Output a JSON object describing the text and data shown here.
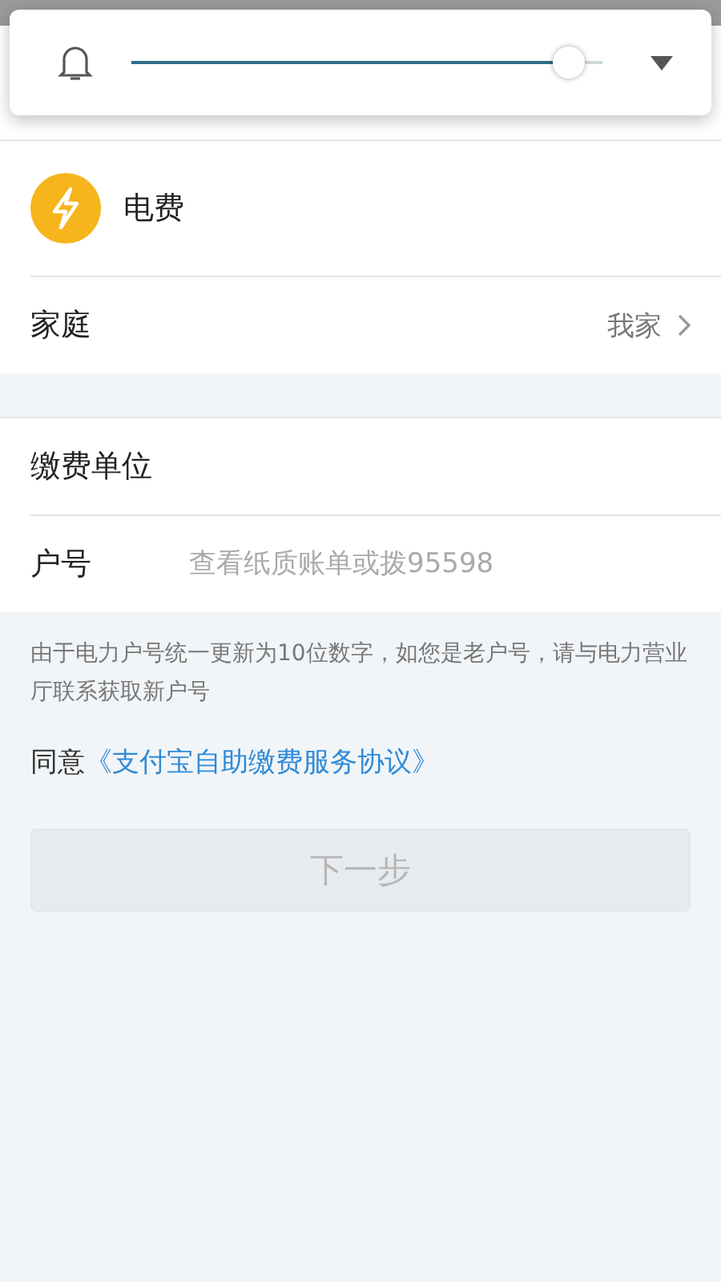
{
  "volume_popup": {
    "level": 0.93
  },
  "biller": {
    "name": "电费"
  },
  "group_row": {
    "label": "家庭",
    "value": "我家"
  },
  "form": [
    {
      "label": "缴费单位"
    },
    {
      "label": "户号",
      "placeholder": "查看纸质账单或拨95598"
    }
  ],
  "note": "由于电力户号统一更新为10位数字，如您是老户号，请与电力营业厅联系获取新户号",
  "agreement": {
    "prefix": "同意",
    "link": "《支付宝自助缴费服务协议》"
  },
  "next_button": {
    "label": "下一步",
    "disabled": true
  }
}
